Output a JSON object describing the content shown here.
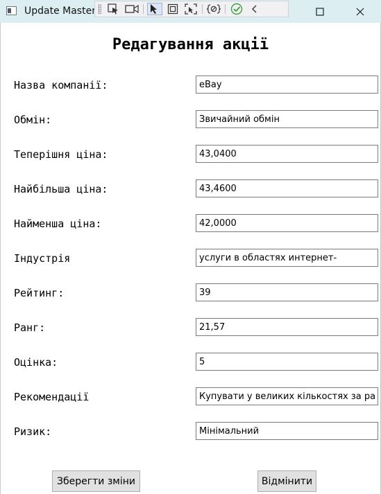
{
  "window": {
    "title": "Update Master",
    "icons": {
      "app": "app-window-icon",
      "toolbar": [
        "select-element-icon",
        "live-preview-icon",
        "pointer-select-icon",
        "display-layout-adorners-icon",
        "track-focus-icon",
        "binding-failures-icon",
        "accessibility-check-icon",
        "collapse-toolbar-icon"
      ],
      "captions": [
        "minimize-icon",
        "maximize-icon",
        "close-icon"
      ]
    }
  },
  "form": {
    "title": "Редагування акції",
    "fields": [
      {
        "label": "Назва компанії:",
        "value": "eBay"
      },
      {
        "label": "Обмін:",
        "value": "Звичайний обмін"
      },
      {
        "label": "Теперішня ціна:",
        "value": "43,0400"
      },
      {
        "label": "Найбільша ціна:",
        "value": "43,4600"
      },
      {
        "label": "Найменша ціна:",
        "value": "42,0000"
      },
      {
        "label": "Індустрія",
        "value": "услуги в областях интернет-"
      },
      {
        "label": "Рейтинг:",
        "value": "39"
      },
      {
        "label": "Ранг:",
        "value": "21,57"
      },
      {
        "label": "Оцінка:",
        "value": "5"
      },
      {
        "label": "Рекомендації",
        "value": "Купувати у великих кількостях за раз"
      },
      {
        "label": "Ризик:",
        "value": "Мінімальний"
      }
    ]
  },
  "actions": {
    "save_label": "Зберегти зміни",
    "cancel_label": "Відмінити"
  },
  "colors": {
    "titlebar": "#ddeef3",
    "button_face": "#e1e1e1",
    "accessibility_check": "#3aa13a"
  }
}
